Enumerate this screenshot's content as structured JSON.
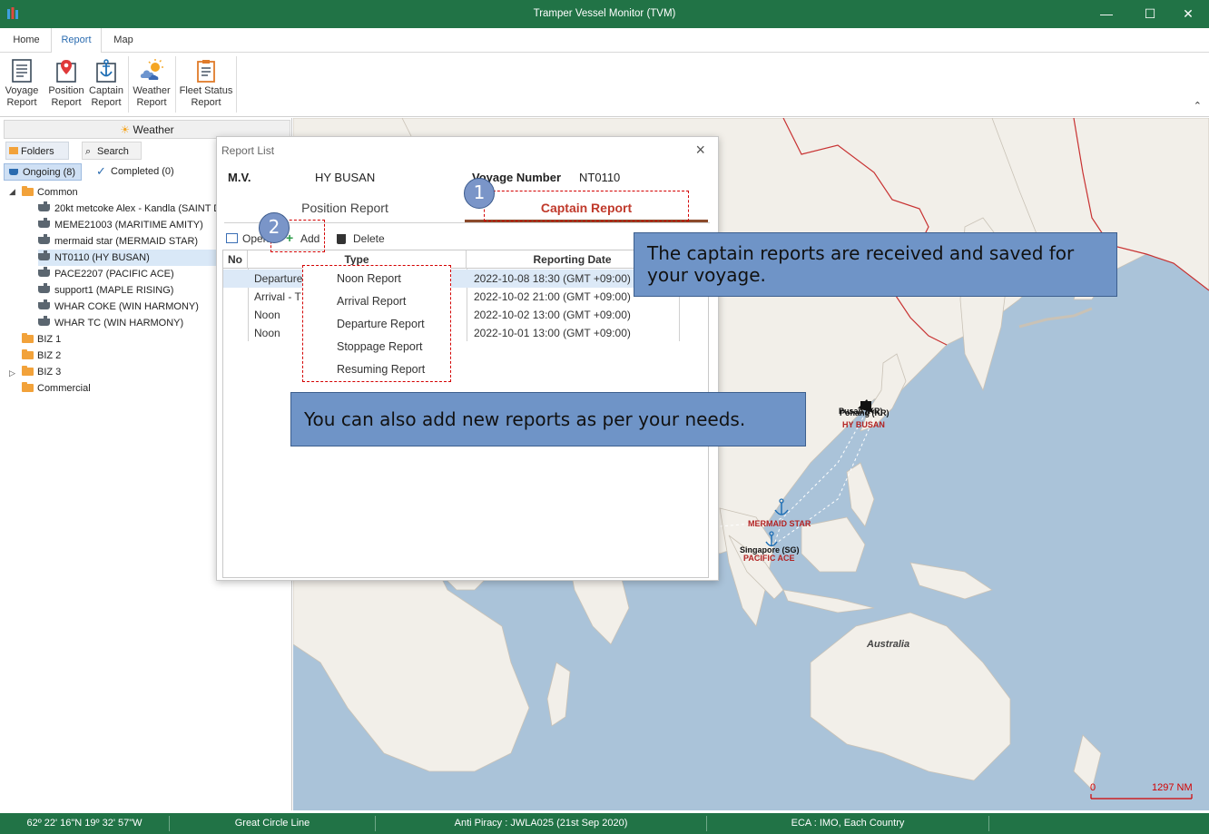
{
  "window": {
    "title": "Tramper Vessel Monitor (TVM)",
    "minimize": "—",
    "maximize": "☐",
    "close": "✕"
  },
  "ribbon_tabs": [
    "Home",
    "Report",
    "Map"
  ],
  "ribbon_buttons": [
    {
      "line1": "Voyage",
      "line2": "Report",
      "icon": "document-icon"
    },
    {
      "line1": "Position",
      "line2": "Report",
      "icon": "map-pin-icon"
    },
    {
      "line1": "Captain",
      "line2": "Report",
      "icon": "anchor-icon"
    },
    {
      "line1": "Weather",
      "line2": "Report",
      "icon": "weather-icon"
    },
    {
      "line1": "Fleet Status",
      "line2": "Report",
      "icon": "clipboard-icon"
    }
  ],
  "left_panel": {
    "weather_label": "Weather",
    "tab_folders": "Folders",
    "tab_search": "Search",
    "filter_ongoing": "Ongoing (8)",
    "filter_completed": "Completed (0)",
    "tree": {
      "common": "Common",
      "voyages": [
        "20kt metcoke Alex - Kandla (SAINT D",
        "MEME21003 (MARITIME AMITY)",
        "mermaid star (MERMAID STAR)",
        "NT0110 (HY BUSAN)",
        "PACE2207 (PACIFIC ACE)",
        "support1 (MAPLE RISING)",
        "WHAR COKE (WIN HARMONY)",
        "WHAR TC (WIN HARMONY)"
      ],
      "folders": [
        "BIZ 1",
        "BIZ 2",
        "BIZ 3",
        "Commercial"
      ]
    }
  },
  "dialog": {
    "title": "Report List",
    "mv_label": "M.V.",
    "mv_value": "HY BUSAN",
    "voyage_label": "Voyage Number",
    "voyage_value": "NT0110",
    "tab_position": "Position Report",
    "tab_captain": "Captain Report",
    "toolbar": {
      "open": "Open",
      "add": "Add",
      "delete": "Delete"
    },
    "columns": [
      "No",
      "Type",
      "Reporting Date"
    ],
    "rows": [
      {
        "type": "Departure",
        "date": "2022-10-08 18:30 (GMT +09:00)"
      },
      {
        "type": "Arrival - T",
        "date": "2022-10-02 21:00 (GMT +09:00)"
      },
      {
        "type": "Noon",
        "date": "2022-10-02 13:00 (GMT +09:00)"
      },
      {
        "type": "Noon",
        "date": "2022-10-01 13:00 (GMT +09:00)"
      }
    ],
    "add_menu": [
      "Noon Report",
      "Arrival Report",
      "Departure Report",
      "Stoppage Report",
      "Resuming Report"
    ]
  },
  "annotations": {
    "badge1": "1",
    "badge2": "2",
    "callout1": "The captain reports are received and saved for your voyage.",
    "callout2": "You can also add new reports as per your needs."
  },
  "map": {
    "labels": {
      "pohang_port": "Pohang (KR)",
      "busan_port": "Pusan (KR)",
      "hy_busan": "HY BUSAN",
      "mermaid_star": "MERMAID STAR",
      "singapore": "Singapore (SG)",
      "pacific_ace": "PACIFIC ACE",
      "australia": "Australia"
    },
    "scale_zero": "0",
    "scale_value": "1297 NM"
  },
  "status_bar": {
    "coords": "62º 22' 16\"N 19º 32' 57\"W",
    "route": "Great Circle Line",
    "piracy": "Anti Piracy : JWLA025 (21st Sep 2020)",
    "eca": "ECA : IMO, Each Country"
  },
  "colors": {
    "titlebar": "#217346",
    "accent_blue": "#2b6cb0",
    "annotation_red": "#d40000",
    "callout_fill": "#6f94c7",
    "map_sea": "#aac3d9",
    "map_land": "#f2efe9"
  }
}
